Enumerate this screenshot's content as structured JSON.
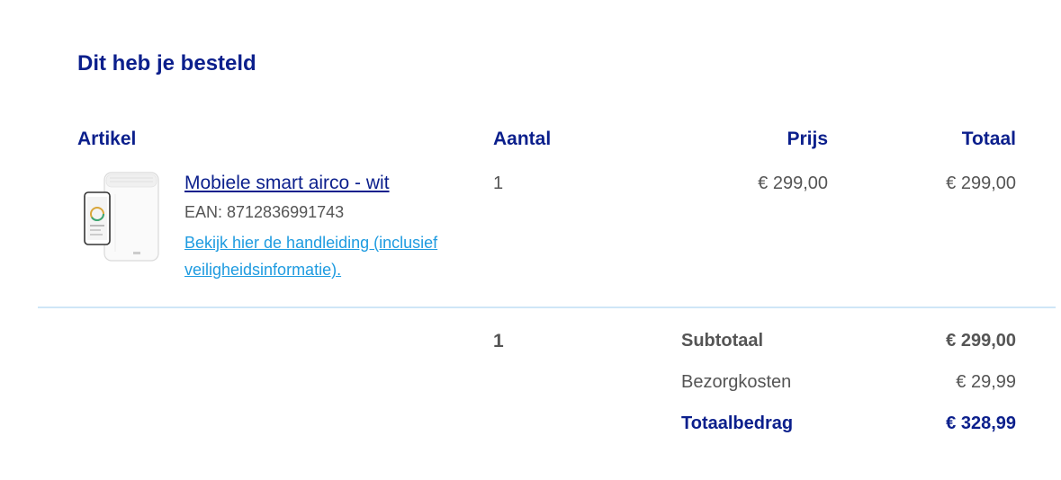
{
  "order": {
    "title": "Dit heb je besteld",
    "columns": {
      "article": "Artikel",
      "quantity": "Aantal",
      "price": "Prijs",
      "total": "Totaal"
    },
    "items": [
      {
        "name": "Mobiele smart airco - wit",
        "ean": "EAN: 8712836991743",
        "manual_link": "Bekijk hier de handleiding (inclusief veiligheidsinformatie).",
        "quantity": "1",
        "price": "€ 299,00",
        "total": "€ 299,00",
        "image_icon": "air-conditioner-with-phone-icon"
      }
    ],
    "summary": {
      "total_quantity": "1",
      "subtotal_label": "Subtotaal",
      "subtotal_value": "€ 299,00",
      "delivery_label": "Bezorgkosten",
      "delivery_value": "€ 29,99",
      "grand_total_label": "Totaalbedrag",
      "grand_total_value": "€ 328,99"
    }
  },
  "colors": {
    "heading": "#0b1f8c",
    "link": "#1e9be0",
    "text": "#555555",
    "divider": "#cfe6f7"
  }
}
